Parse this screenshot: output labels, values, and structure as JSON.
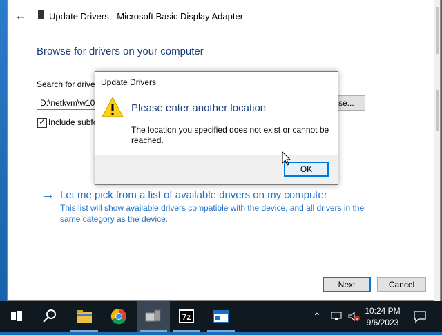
{
  "window": {
    "title": "Update Drivers - Microsoft Basic Display Adapter",
    "heading": "Browse for drivers on your computer",
    "search_label": "Search for drive",
    "path_value": "D:\\netkvm\\w10",
    "browse_label": "se...",
    "include_label": "Include subfo",
    "pick_link": "Let me pick from a list of available drivers on my computer",
    "pick_desc": "This list will show available drivers compatible with the device, and all drivers in the same category as the device.",
    "next_label": "Next",
    "cancel_label": "Cancel"
  },
  "dialog": {
    "title": "Update Drivers",
    "main_message": "Please enter another location",
    "sub_message": "The location you specified does not exist or cannot be reached.",
    "ok_label": "OK"
  },
  "taskbar": {
    "time": "10:24 PM",
    "date": "9/6/2023",
    "icons": [
      "start-icon",
      "search-icon",
      "file-explorer-icon",
      "chrome-icon",
      "device-manager-icon",
      "7zip-icon",
      "window-app-icon"
    ],
    "seven_zip_label": "7z"
  },
  "colors": {
    "accent": "#0078d7",
    "heading": "#1e3f7a",
    "link": "#1e6fc8",
    "taskbar": "#101820"
  }
}
